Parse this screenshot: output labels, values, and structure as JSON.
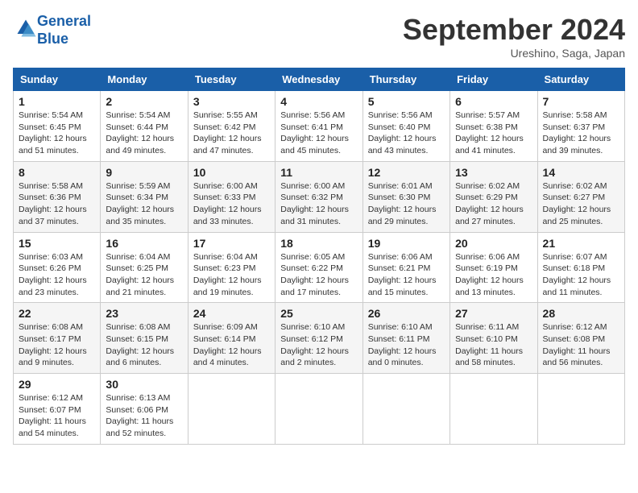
{
  "logo": {
    "line1": "General",
    "line2": "Blue"
  },
  "title": "September 2024",
  "location": "Ureshino, Saga, Japan",
  "weekdays": [
    "Sunday",
    "Monday",
    "Tuesday",
    "Wednesday",
    "Thursday",
    "Friday",
    "Saturday"
  ],
  "weeks": [
    [
      {
        "day": "1",
        "info": "Sunrise: 5:54 AM\nSunset: 6:45 PM\nDaylight: 12 hours\nand 51 minutes."
      },
      {
        "day": "2",
        "info": "Sunrise: 5:54 AM\nSunset: 6:44 PM\nDaylight: 12 hours\nand 49 minutes."
      },
      {
        "day": "3",
        "info": "Sunrise: 5:55 AM\nSunset: 6:42 PM\nDaylight: 12 hours\nand 47 minutes."
      },
      {
        "day": "4",
        "info": "Sunrise: 5:56 AM\nSunset: 6:41 PM\nDaylight: 12 hours\nand 45 minutes."
      },
      {
        "day": "5",
        "info": "Sunrise: 5:56 AM\nSunset: 6:40 PM\nDaylight: 12 hours\nand 43 minutes."
      },
      {
        "day": "6",
        "info": "Sunrise: 5:57 AM\nSunset: 6:38 PM\nDaylight: 12 hours\nand 41 minutes."
      },
      {
        "day": "7",
        "info": "Sunrise: 5:58 AM\nSunset: 6:37 PM\nDaylight: 12 hours\nand 39 minutes."
      }
    ],
    [
      {
        "day": "8",
        "info": "Sunrise: 5:58 AM\nSunset: 6:36 PM\nDaylight: 12 hours\nand 37 minutes."
      },
      {
        "day": "9",
        "info": "Sunrise: 5:59 AM\nSunset: 6:34 PM\nDaylight: 12 hours\nand 35 minutes."
      },
      {
        "day": "10",
        "info": "Sunrise: 6:00 AM\nSunset: 6:33 PM\nDaylight: 12 hours\nand 33 minutes."
      },
      {
        "day": "11",
        "info": "Sunrise: 6:00 AM\nSunset: 6:32 PM\nDaylight: 12 hours\nand 31 minutes."
      },
      {
        "day": "12",
        "info": "Sunrise: 6:01 AM\nSunset: 6:30 PM\nDaylight: 12 hours\nand 29 minutes."
      },
      {
        "day": "13",
        "info": "Sunrise: 6:02 AM\nSunset: 6:29 PM\nDaylight: 12 hours\nand 27 minutes."
      },
      {
        "day": "14",
        "info": "Sunrise: 6:02 AM\nSunset: 6:27 PM\nDaylight: 12 hours\nand 25 minutes."
      }
    ],
    [
      {
        "day": "15",
        "info": "Sunrise: 6:03 AM\nSunset: 6:26 PM\nDaylight: 12 hours\nand 23 minutes."
      },
      {
        "day": "16",
        "info": "Sunrise: 6:04 AM\nSunset: 6:25 PM\nDaylight: 12 hours\nand 21 minutes."
      },
      {
        "day": "17",
        "info": "Sunrise: 6:04 AM\nSunset: 6:23 PM\nDaylight: 12 hours\nand 19 minutes."
      },
      {
        "day": "18",
        "info": "Sunrise: 6:05 AM\nSunset: 6:22 PM\nDaylight: 12 hours\nand 17 minutes."
      },
      {
        "day": "19",
        "info": "Sunrise: 6:06 AM\nSunset: 6:21 PM\nDaylight: 12 hours\nand 15 minutes."
      },
      {
        "day": "20",
        "info": "Sunrise: 6:06 AM\nSunset: 6:19 PM\nDaylight: 12 hours\nand 13 minutes."
      },
      {
        "day": "21",
        "info": "Sunrise: 6:07 AM\nSunset: 6:18 PM\nDaylight: 12 hours\nand 11 minutes."
      }
    ],
    [
      {
        "day": "22",
        "info": "Sunrise: 6:08 AM\nSunset: 6:17 PM\nDaylight: 12 hours\nand 9 minutes."
      },
      {
        "day": "23",
        "info": "Sunrise: 6:08 AM\nSunset: 6:15 PM\nDaylight: 12 hours\nand 6 minutes."
      },
      {
        "day": "24",
        "info": "Sunrise: 6:09 AM\nSunset: 6:14 PM\nDaylight: 12 hours\nand 4 minutes."
      },
      {
        "day": "25",
        "info": "Sunrise: 6:10 AM\nSunset: 6:12 PM\nDaylight: 12 hours\nand 2 minutes."
      },
      {
        "day": "26",
        "info": "Sunrise: 6:10 AM\nSunset: 6:11 PM\nDaylight: 12 hours\nand 0 minutes."
      },
      {
        "day": "27",
        "info": "Sunrise: 6:11 AM\nSunset: 6:10 PM\nDaylight: 11 hours\nand 58 minutes."
      },
      {
        "day": "28",
        "info": "Sunrise: 6:12 AM\nSunset: 6:08 PM\nDaylight: 11 hours\nand 56 minutes."
      }
    ],
    [
      {
        "day": "29",
        "info": "Sunrise: 6:12 AM\nSunset: 6:07 PM\nDaylight: 11 hours\nand 54 minutes."
      },
      {
        "day": "30",
        "info": "Sunrise: 6:13 AM\nSunset: 6:06 PM\nDaylight: 11 hours\nand 52 minutes."
      },
      null,
      null,
      null,
      null,
      null
    ]
  ]
}
